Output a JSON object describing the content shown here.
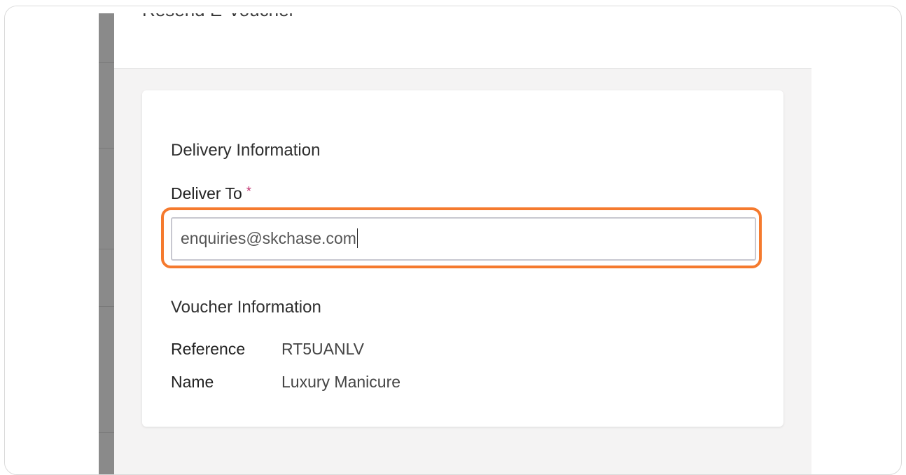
{
  "header": {
    "title": "Resend E-Voucher"
  },
  "delivery": {
    "section_title": "Delivery Information",
    "deliver_to_label": "Deliver To",
    "required_marker": "*",
    "deliver_to_value": "enquiries@skchase.com"
  },
  "voucher": {
    "section_title": "Voucher Information",
    "rows": [
      {
        "label": "Reference",
        "value": "RT5UANLV"
      },
      {
        "label": "Name",
        "value": "Luxury Manicure"
      }
    ]
  },
  "colors": {
    "highlight": "#f57a2e",
    "required": "#c0306e",
    "sidebar": "#8a8a8a",
    "content_bg": "#f4f3f3"
  }
}
